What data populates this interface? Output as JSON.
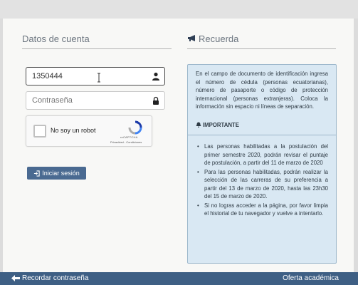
{
  "account": {
    "section_title": "Datos de cuenta",
    "id_value": "1350444",
    "password_placeholder": "Contraseña",
    "login_label": "Iniciar sesión"
  },
  "recaptcha": {
    "checkbox_label": "No soy un robot",
    "brand": "reCAPTCHA",
    "links": "Privacidad - Condiciones"
  },
  "reminder": {
    "section_title": "Recuerda",
    "intro": "En el campo de documento de identificación ingresa el número de cédula (personas ecuatorianas), número de pasaporte o código de protección internacional (personas extranjeras). Coloca la información sin espacio ni líneas de separación.",
    "important_title": "IMPORTANTE",
    "bullets": [
      "Las personas habilitadas a la postulación del primer semestre 2020, podrán revisar el puntaje de postulación, a partir del 11 de marzo de 2020",
      "Para las personas habilitadas, podrán realizar la selección de las carreras de su preferencia a partir del 13 de marzo de 2020, hasta las 23h30 del 15 de marzo de 2020.",
      "Si no logras acceder a la página, por favor limpia el historial de tu navegador y vuelve a intentarlo."
    ]
  },
  "footer": {
    "recover_label": "Recordar contraseña",
    "academic_offer_label": "Oferta académica"
  },
  "colors": {
    "accent": "#3e5f84",
    "button": "#4a6a91",
    "info_bg": "#d9e8f3"
  },
  "icons": [
    "user-icon",
    "lock-icon",
    "megaphone-icon",
    "recaptcha-logo-icon",
    "login-icon",
    "bell-icon",
    "arrow-left-icon"
  ]
}
